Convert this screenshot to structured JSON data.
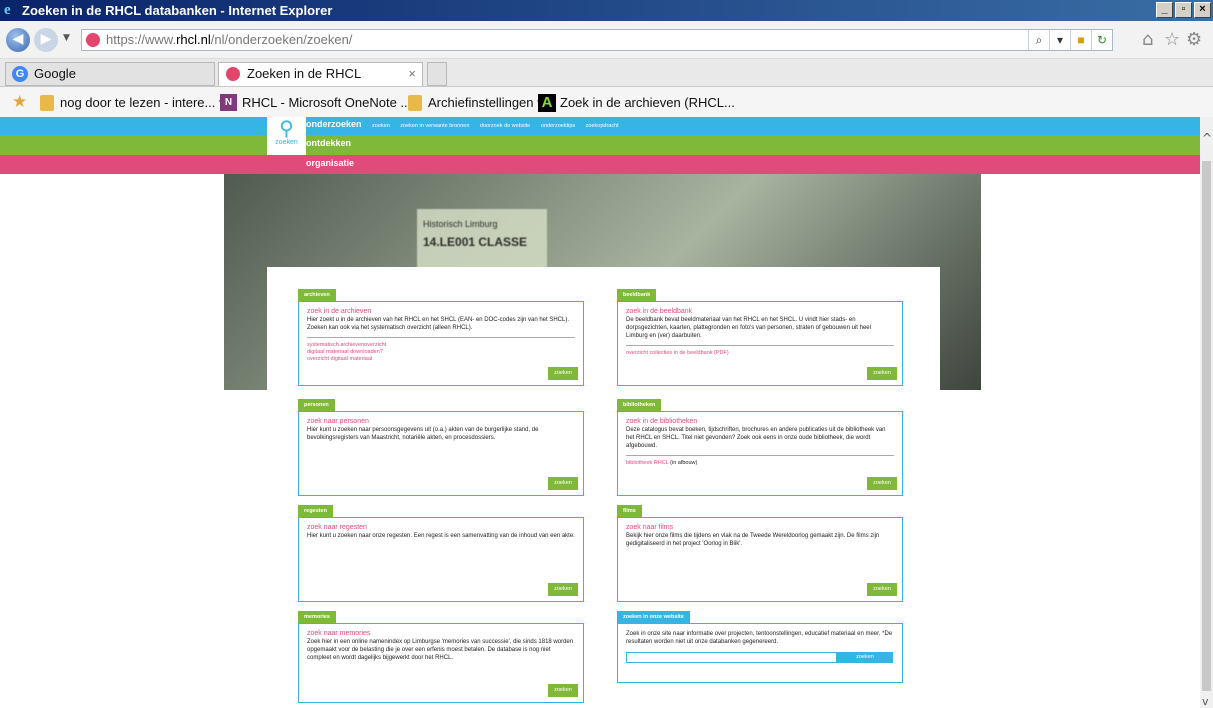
{
  "window": {
    "title": "Zoeken in de RHCL databanken - Internet Explorer",
    "minimize": "_",
    "maximize": "▫",
    "close": "×"
  },
  "address": {
    "prefix": "https://www.",
    "domain": "rhcl.nl",
    "path": "/nl/onderzoeken/zoeken/"
  },
  "tabs": [
    {
      "label": "Google"
    },
    {
      "label": "Zoeken in de RHCL databan...",
      "close": "×"
    }
  ],
  "favorites": [
    {
      "label": "nog door te lezen - intere... ▾"
    },
    {
      "label": "RHCL - Microsoft OneNote ..."
    },
    {
      "label": "Archiefinstellingen ▾"
    },
    {
      "label": "Zoek in de archieven (RHCL..."
    }
  ],
  "site": {
    "logo_label": "zoeken",
    "nav": {
      "onderzoeken": "onderzoeken",
      "subitems": [
        "zoeken",
        "zoeken in verwante bronnen",
        "doorzoek de website",
        "onderzoektips",
        "zoekopdracht"
      ],
      "ontdekken": "ontdekken",
      "organisatie": "organisatie"
    },
    "hero": {
      "line1": "Historisch Limburg",
      "line2": "14.LE001 CLASSE"
    }
  },
  "categories": {
    "archieven": {
      "tag": "archieven",
      "title": "zoek in de archieven",
      "text": "Hier zoekt u in de archieven van het RHCL en het SHCL (EAN- en DOC-codes zijn van het SHCL). Zoeken kan ook via het systematisch overzicht (alleen RHCL).",
      "links": [
        "systematisch archievenoverzicht",
        "digitaal materiaal downloaden?",
        "overzicht digitaal materiaal"
      ],
      "button": "zoeken"
    },
    "beeldbank": {
      "tag": "beeldbank",
      "title": "zoek in de beeldbank",
      "text": "De beeldbank bevat beeldmateriaal van het RHCL en het SHCL. U vindt hier stads- en dorpsgezichten, kaarten, plattegronden en foto's van personen, straten of gebouwen uit heel Limburg en (ver) daarbuiten.",
      "links": [
        "overzicht collecties in de beeldbank (PDF)"
      ],
      "button": "zoeken"
    },
    "personen": {
      "tag": "personen",
      "title": "zoek naar personen",
      "text": "Hier kunt u zoeken naar persoonsgegevens uit (o.a.) akten van de burgerlijke stand, de bevolkingsregisters van Maastricht, notariële akten, en procesdossiers.",
      "button": "zoeken"
    },
    "bibliotheken": {
      "tag": "bibliotheken",
      "title": "zoek in de bibliotheken",
      "text": "Deze catalogus bevat boeken, tijdschriften, brochures en andere publicaties uit de bibliotheek van het RHCL en SHCL. Titel niet gevonden? Zoek ook eens in onze oude bibliotheek, die wordt afgebouwd.",
      "link": "bibliotheek RHCL",
      "link_suffix": " (in afbouw)",
      "button": "zoeken"
    },
    "regesten": {
      "tag": "regesten",
      "title": "zoek naar regesten",
      "text": "Hier kunt u zoeken naar onze regesten. Een regest is een samenvatting van de inhoud van een akte.",
      "button": "zoeken"
    },
    "films": {
      "tag": "films",
      "title": "zoek naar films",
      "text": "Bekijk hier onze films die tijdens en vlak na de Tweede Wereldoorlog gemaakt zijn. De films zijn gedigitaliseerd in het project 'Oorlog in Blik'.",
      "button": "zoeken"
    },
    "memories": {
      "tag": "memories",
      "title": "zoek naar memories",
      "text": "Zoek hier in een online namenindex op Limburgse 'memories van successie', die sinds 1818 worden opgemaakt voor de belasting die je over een erfenis moest betalen. De database is nog niet compleet en wordt dagelijks bijgewerkt door het RHCL.",
      "button": "zoeken"
    },
    "website": {
      "tag": "zoeken in onze website",
      "text": "Zoek in onze site naar informatie over projecten, tentoonstellingen, educatief materiaal en meer. *De resultaten worden niet uit onze databanken gegenereerd.",
      "button": "zoeken"
    }
  },
  "colors": {
    "blue": "#35b5e4",
    "green": "#80b83a",
    "pink": "#e04b7b"
  }
}
